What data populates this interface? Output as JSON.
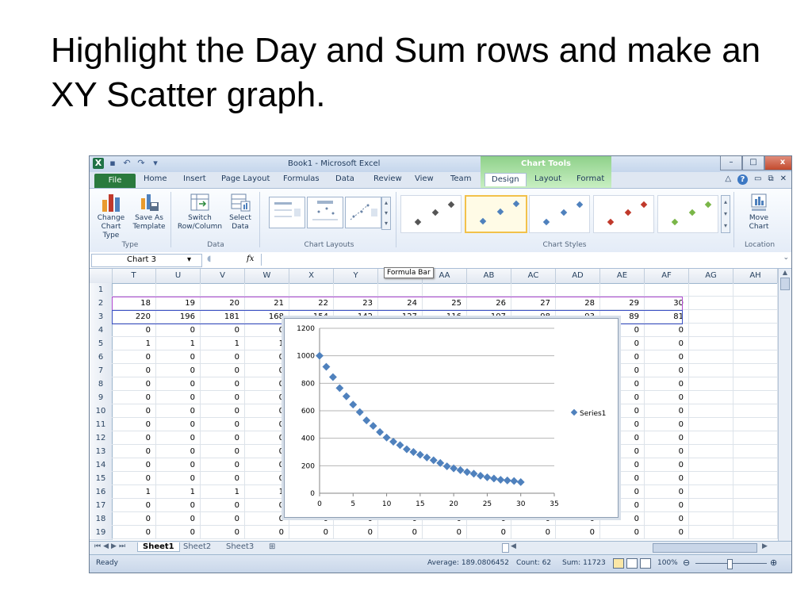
{
  "slide": {
    "title": "Highlight the Day and Sum rows and make an XY Scatter graph."
  },
  "window": {
    "title": "Book1 - Microsoft Excel",
    "tools_label": "Chart Tools",
    "controls": {
      "minimize": "–",
      "restore": "□",
      "close": "x"
    }
  },
  "tabs": {
    "file": "File",
    "home": "Home",
    "insert": "Insert",
    "page_layout": "Page Layout",
    "formulas": "Formulas",
    "data": "Data",
    "review": "Review",
    "view": "View",
    "team": "Team",
    "design": "Design",
    "layout": "Layout",
    "format": "Format"
  },
  "ribbon": {
    "change_chart_type": [
      "Change",
      "Chart Type"
    ],
    "save_as_template": [
      "Save As",
      "Template"
    ],
    "switch_row_column": [
      "Switch",
      "Row/Column"
    ],
    "select_data": [
      "Select",
      "Data"
    ],
    "move_chart": [
      "Move",
      "Chart"
    ],
    "groups": {
      "type": "Type",
      "data": "Data",
      "chart_layouts": "Chart Layouts",
      "chart_styles": "Chart Styles",
      "location": "Location"
    }
  },
  "formula_bar": {
    "name_box": "Chart 3",
    "fx": "fx",
    "tooltip": "Formula Bar"
  },
  "columns": [
    "T",
    "U",
    "V",
    "W",
    "X",
    "Y",
    "Z",
    "AA",
    "AB",
    "AC",
    "AD",
    "AE",
    "AF",
    "AG",
    "AH"
  ],
  "rows": [
    {
      "n": "1",
      "cells": [
        "",
        "",
        "",
        "",
        "",
        "",
        "",
        "",
        "",
        "",
        "",
        "",
        "",
        "",
        ""
      ]
    },
    {
      "n": "2",
      "cells": [
        "18",
        "19",
        "20",
        "21",
        "22",
        "23",
        "24",
        "25",
        "26",
        "27",
        "28",
        "29",
        "30",
        "",
        ""
      ]
    },
    {
      "n": "3",
      "cells": [
        "220",
        "196",
        "181",
        "168",
        "154",
        "142",
        "127",
        "116",
        "107",
        "98",
        "93",
        "89",
        "81",
        "",
        ""
      ]
    },
    {
      "n": "4",
      "cells": [
        "0",
        "0",
        "0",
        "0",
        "",
        "",
        "",
        "",
        "",
        "",
        "",
        "0",
        "0",
        "",
        ""
      ]
    },
    {
      "n": "5",
      "cells": [
        "1",
        "1",
        "1",
        "1",
        "",
        "",
        "",
        "",
        "",
        "",
        "",
        "0",
        "0",
        "",
        ""
      ]
    },
    {
      "n": "6",
      "cells": [
        "0",
        "0",
        "0",
        "0",
        "",
        "",
        "",
        "",
        "",
        "",
        "",
        "0",
        "0",
        "",
        ""
      ]
    },
    {
      "n": "7",
      "cells": [
        "0",
        "0",
        "0",
        "0",
        "",
        "",
        "",
        "",
        "",
        "",
        "",
        "0",
        "0",
        "",
        ""
      ]
    },
    {
      "n": "8",
      "cells": [
        "0",
        "0",
        "0",
        "0",
        "",
        "",
        "",
        "",
        "",
        "",
        "",
        "0",
        "0",
        "",
        ""
      ]
    },
    {
      "n": "9",
      "cells": [
        "0",
        "0",
        "0",
        "0",
        "",
        "",
        "",
        "",
        "",
        "",
        "",
        "0",
        "0",
        "",
        ""
      ]
    },
    {
      "n": "10",
      "cells": [
        "0",
        "0",
        "0",
        "0",
        "",
        "",
        "",
        "",
        "",
        "",
        "",
        "0",
        "0",
        "",
        ""
      ]
    },
    {
      "n": "11",
      "cells": [
        "0",
        "0",
        "0",
        "0",
        "",
        "",
        "",
        "",
        "",
        "",
        "",
        "0",
        "0",
        "",
        ""
      ]
    },
    {
      "n": "12",
      "cells": [
        "0",
        "0",
        "0",
        "0",
        "",
        "",
        "",
        "",
        "",
        "",
        "",
        "0",
        "0",
        "",
        ""
      ]
    },
    {
      "n": "13",
      "cells": [
        "0",
        "0",
        "0",
        "0",
        "",
        "",
        "",
        "",
        "",
        "",
        "",
        "0",
        "0",
        "",
        ""
      ]
    },
    {
      "n": "14",
      "cells": [
        "0",
        "0",
        "0",
        "0",
        "",
        "",
        "",
        "",
        "",
        "",
        "",
        "0",
        "0",
        "",
        ""
      ]
    },
    {
      "n": "15",
      "cells": [
        "0",
        "0",
        "0",
        "0",
        "",
        "",
        "",
        "",
        "",
        "",
        "",
        "0",
        "0",
        "",
        ""
      ]
    },
    {
      "n": "16",
      "cells": [
        "1",
        "1",
        "1",
        "1",
        "",
        "",
        "",
        "",
        "",
        "",
        "",
        "0",
        "0",
        "",
        ""
      ]
    },
    {
      "n": "17",
      "cells": [
        "0",
        "0",
        "0",
        "0",
        "",
        "",
        "",
        "",
        "",
        "",
        "",
        "0",
        "0",
        "",
        ""
      ]
    },
    {
      "n": "18",
      "cells": [
        "0",
        "0",
        "0",
        "0",
        "0",
        "0",
        "0",
        "0",
        "0",
        "0",
        "0",
        "0",
        "0",
        "",
        ""
      ]
    },
    {
      "n": "19",
      "cells": [
        "0",
        "0",
        "0",
        "0",
        "0",
        "0",
        "0",
        "0",
        "0",
        "0",
        "0",
        "0",
        "0",
        "",
        ""
      ]
    }
  ],
  "sheets": [
    "Sheet1",
    "Sheet2",
    "Sheet3"
  ],
  "status": {
    "ready": "Ready",
    "average": "Average: 189.0806452",
    "count": "Count: 62",
    "sum": "Sum: 11723",
    "zoom": "100%"
  },
  "colors": {
    "series": "#4f81bd",
    "selection_purple": "#b14ad1",
    "selection_blue": "#3b50c4",
    "chart_tools_green": "#8fd18a"
  },
  "chart_data": {
    "type": "scatter",
    "series": [
      {
        "name": "Series1",
        "x": [
          0,
          1,
          2,
          3,
          4,
          5,
          6,
          7,
          8,
          9,
          10,
          11,
          12,
          13,
          14,
          15,
          16,
          17,
          18,
          19,
          20,
          21,
          22,
          23,
          24,
          25,
          26,
          27,
          28,
          29,
          30
        ],
        "y": [
          1000,
          920,
          845,
          765,
          705,
          645,
          590,
          530,
          490,
          445,
          405,
          375,
          350,
          320,
          300,
          280,
          260,
          240,
          220,
          196,
          181,
          168,
          154,
          142,
          127,
          116,
          107,
          98,
          93,
          89,
          81
        ]
      }
    ],
    "xlim": [
      0,
      35
    ],
    "ylim": [
      0,
      1200
    ],
    "xticks": [
      "0",
      "5",
      "10",
      "15",
      "20",
      "25",
      "30",
      "35"
    ],
    "yticks": [
      "0",
      "200",
      "400",
      "600",
      "800",
      "1000",
      "1200"
    ],
    "grid": "horizontal",
    "legend": "right"
  }
}
